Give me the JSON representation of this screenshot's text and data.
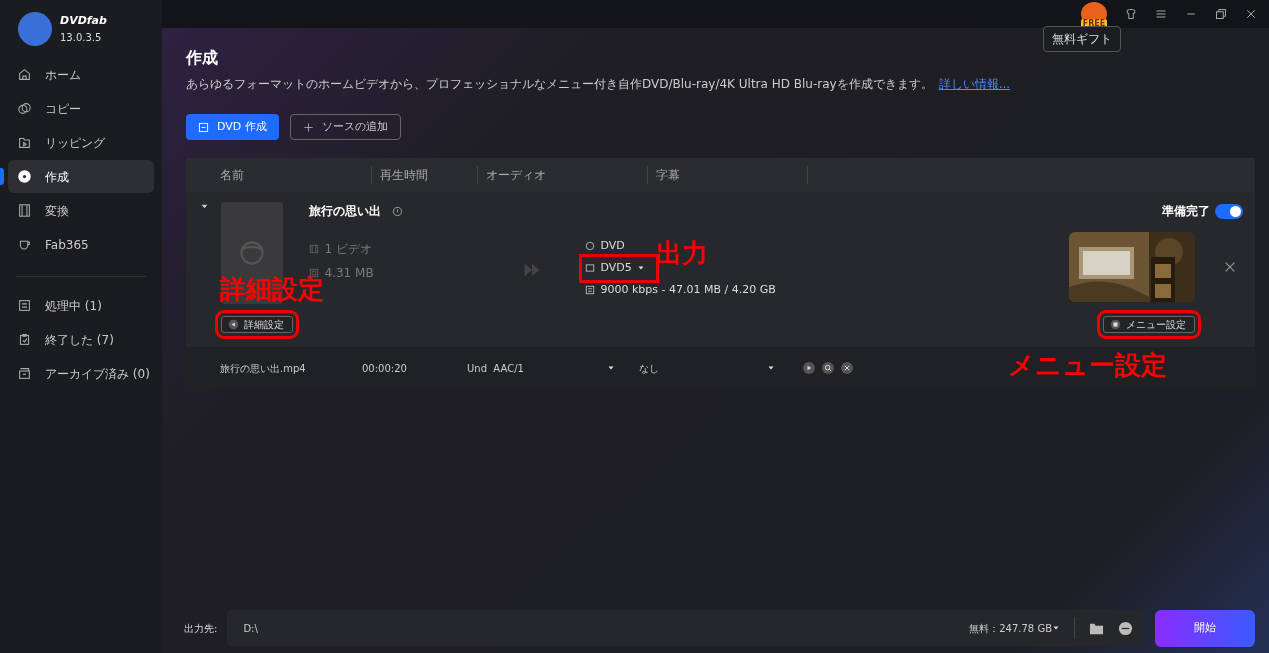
{
  "app": {
    "name": "DVDfab",
    "version": "13.0.3.5"
  },
  "titlebar": {
    "gift_badge": "FREE",
    "tooltip": "無料ギフト"
  },
  "sidebar": {
    "items": [
      {
        "label": "ホーム",
        "selected": false
      },
      {
        "label": "コピー",
        "selected": false
      },
      {
        "label": "リッピング",
        "selected": false
      },
      {
        "label": "作成",
        "selected": true
      },
      {
        "label": "変換",
        "selected": false
      },
      {
        "label": "Fab365",
        "selected": false
      }
    ],
    "queue": [
      {
        "label": "処理中 (1)"
      },
      {
        "label": "終了した (7)"
      },
      {
        "label": "アーカイブ済み (0)"
      }
    ]
  },
  "page": {
    "title": "作成",
    "description": "あらゆるフォーマットのホームビデオから、プロフェッショナルなメニュー付き自作DVD/Blu-ray/4K Ultra HD Blu-rayを作成できます。",
    "link": "詳しい情報...",
    "buttons": [
      {
        "label": "DVD 作成",
        "kind": "primary"
      },
      {
        "label": "ソースの追加",
        "kind": "outline"
      }
    ]
  },
  "table": {
    "columns": [
      "名前",
      "再生時間",
      "オーディオ",
      "字幕"
    ],
    "item": {
      "title": "旅行の思い出",
      "expanded": true,
      "videos": "1 ビデオ",
      "size": "4.31 MB",
      "output_format": "DVD",
      "disc": "DVD5",
      "bitrate": "9000 kbps - 47.01 MB / 4.20 GB",
      "ready_label": "準備完了",
      "ready": true,
      "advanced_button": "詳細設定",
      "menu_button": "メニュー設定"
    },
    "tracks": [
      {
        "file": "旅行の思い出.mp4",
        "duration": "00:00:20",
        "audio": "Und  AAC/1",
        "subtitle": "なし"
      }
    ]
  },
  "annotations": [
    {
      "kind": "advanced",
      "text": "詳細設定"
    },
    {
      "kind": "output",
      "text": "出力"
    },
    {
      "kind": "menu",
      "text": "メニュー設定"
    }
  ],
  "footer": {
    "label": "出力先:",
    "path": "D:\\",
    "free_space": "無料：247.78 GB",
    "start_button": "開始"
  }
}
